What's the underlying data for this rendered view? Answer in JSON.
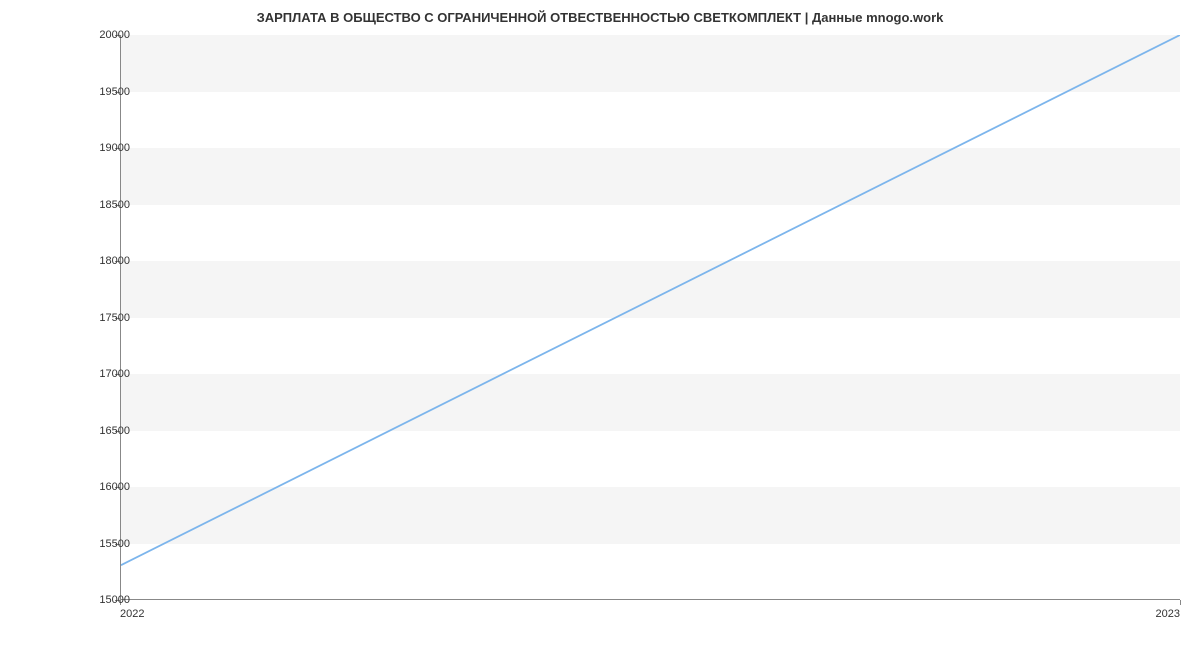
{
  "chart_data": {
    "type": "line",
    "title": "ЗАРПЛАТА В ОБЩЕСТВО С ОГРАНИЧЕННОЙ ОТВЕСТВЕННОСТЬЮ СВЕТКОМПЛЕКТ | Данные mnogo.work",
    "x": [
      2022,
      2023
    ],
    "y": [
      15300,
      20000
    ],
    "xlabel": "",
    "ylabel": "",
    "xlim": [
      2022,
      2023
    ],
    "ylim": [
      15000,
      20000
    ],
    "x_ticks": [
      2022,
      2023
    ],
    "y_ticks": [
      15000,
      15500,
      16000,
      16500,
      17000,
      17500,
      18000,
      18500,
      19000,
      19500,
      20000
    ],
    "grid": "banded",
    "colors": {
      "line": "#7cb5ec",
      "band": "#f5f5f5",
      "axis": "#888888"
    }
  }
}
